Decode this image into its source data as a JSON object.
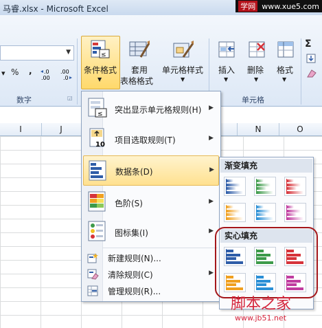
{
  "window": {
    "title": "马睿.xlsx - Microsoft Excel"
  },
  "watermark_top": {
    "tag": "学网",
    "url": "www.xue5.com"
  },
  "ribbon": {
    "number_symbols": {
      "percent": "%",
      "comma": ",",
      "inc_decimal": "←.0 .00",
      "dec_decimal": ".00 →.0"
    },
    "number_group_label": "数字",
    "cond_format": "条件格式",
    "table_format_line1": "套用",
    "table_format_line2": "表格格式",
    "cell_style": "单元格样式",
    "insert": "插入",
    "delete": "删除",
    "format": "格式",
    "cells_group_label": "单元格",
    "sigma": "Σ"
  },
  "columns": [
    "I",
    "J",
    "N",
    "O"
  ],
  "menu": {
    "items": [
      {
        "label": "突出显示单元格规则(H)",
        "icon": "highlight-rules-icon"
      },
      {
        "label": "项目选取规则(T)",
        "icon": "top-bottom-rules-icon"
      },
      {
        "label": "数据条(D)",
        "icon": "data-bars-icon"
      },
      {
        "label": "色阶(S)",
        "icon": "color-scales-icon"
      },
      {
        "label": "图标集(I)",
        "icon": "icon-sets-icon"
      }
    ],
    "small_items": [
      {
        "label": "新建规则(N)...",
        "icon": "new-rule-icon"
      },
      {
        "label": "清除规则(C)",
        "icon": "clear-rules-icon"
      },
      {
        "label": "管理规则(R)...",
        "icon": "manage-rules-icon"
      }
    ]
  },
  "submenu": {
    "gradient_header": "渐变填充",
    "solid_header": "实心填充",
    "bar_colors": [
      "#2f5da8",
      "#3d9a4a",
      "#d6333a",
      "#f0a020",
      "#2a8fd6",
      "#c03ca0"
    ]
  },
  "watermark_bottom": {
    "big": "脚本之家",
    "small": "www.jb51.net"
  }
}
